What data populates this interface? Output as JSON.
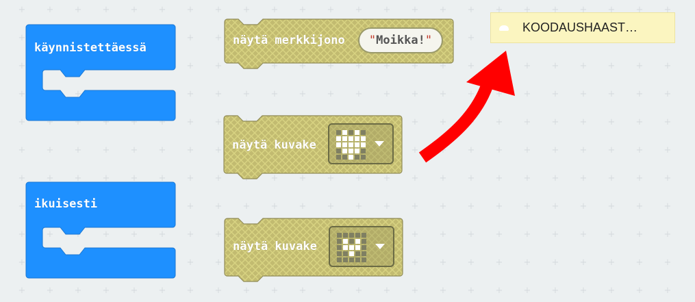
{
  "workspace": {
    "grid_symbol": "+"
  },
  "blocks": {
    "on_start": {
      "label": "käynnistettäessä",
      "color": "#1e90ff"
    },
    "forever": {
      "label": "ikuisesti",
      "color": "#1e90ff"
    },
    "show_string": {
      "label": "näytä merkkijono",
      "quote_open": "\"",
      "quote_close": "\"",
      "value": "Moikka!"
    },
    "show_icon_1": {
      "label": "näytä kuvake",
      "icon": "heart-icon",
      "leds": [
        0,
        1,
        0,
        1,
        0,
        1,
        1,
        1,
        1,
        1,
        1,
        1,
        1,
        1,
        1,
        0,
        1,
        1,
        1,
        0,
        0,
        0,
        1,
        0,
        0
      ]
    },
    "show_icon_2": {
      "label": "näytä kuvake",
      "icon": "small-heart-icon",
      "leds": [
        0,
        0,
        0,
        0,
        0,
        0,
        1,
        0,
        1,
        0,
        0,
        1,
        1,
        1,
        0,
        0,
        0,
        1,
        0,
        0,
        0,
        0,
        0,
        0,
        0
      ]
    },
    "disabled_color": "#c2bb70"
  },
  "tutorial_hint": {
    "text": "KOODAUSHAAST…",
    "icon": "cloud-icon"
  },
  "arrow": {
    "icon": "curved-arrow-icon",
    "color": "#ff0000"
  }
}
